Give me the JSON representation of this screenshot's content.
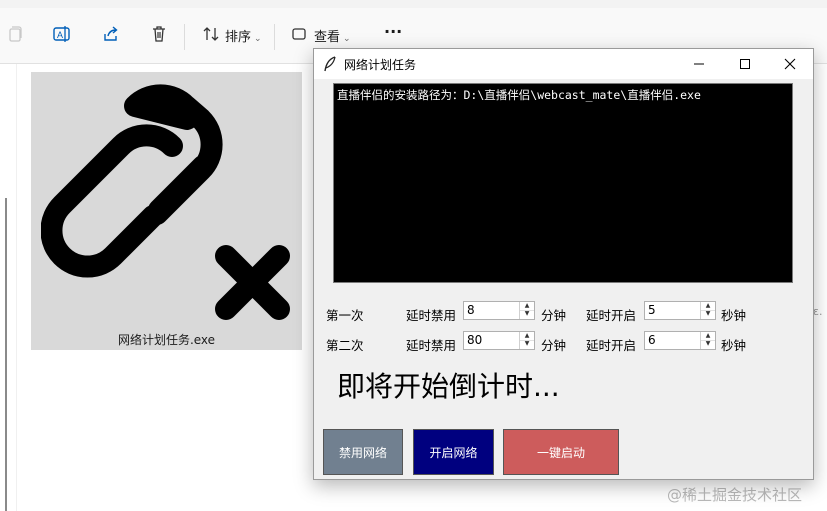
{
  "explorer": {
    "toolbar": {
      "sort_label": "排序",
      "view_label": "查看",
      "more_label": "···"
    },
    "file": {
      "name": "网络计划任务.exe"
    },
    "watermark": "@稀土掘金技术社区"
  },
  "window": {
    "title": "网络计划任务",
    "console_text": "直播伴侣的安装路径为：D:\\直播伴侣\\webcast_mate\\直播伴侣.exe",
    "rows": [
      {
        "label": "第一次",
        "disable_label": "延时禁用",
        "disable_value": "8",
        "disable_unit": "分钟",
        "enable_label": "延时开启",
        "enable_value": "5",
        "enable_unit": "秒钟"
      },
      {
        "label": "第二次",
        "disable_label": "延时禁用",
        "disable_value": "80",
        "disable_unit": "分钟",
        "enable_label": "延时开启",
        "enable_value": "6",
        "enable_unit": "秒钟"
      }
    ],
    "status": "即将开始倒计时...",
    "buttons": {
      "disable_network": "禁用网络",
      "enable_network": "开启网络",
      "one_click_start": "一键启动"
    },
    "colors": {
      "disable_button": "#718090",
      "enable_button": "#00007f",
      "start_button": "#cd5c5c",
      "console_bg": "#000000"
    }
  }
}
